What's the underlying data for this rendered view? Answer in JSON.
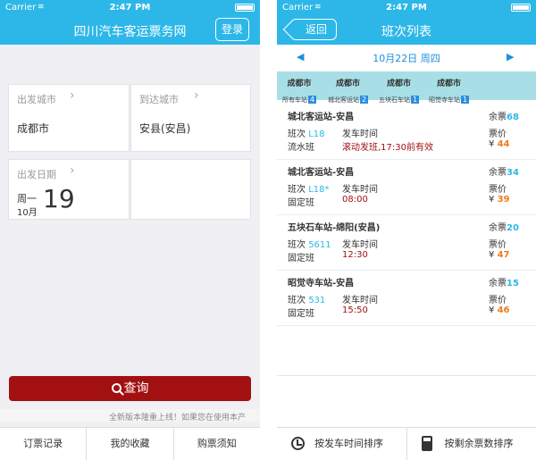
{
  "left": {
    "status": {
      "carrier": "Carrier",
      "wifi": "≋",
      "time": "2:47 PM"
    },
    "nav": {
      "title": "四川汽车客运票务网",
      "login": "登录"
    },
    "from": {
      "label": "出发城市",
      "value": "成都市"
    },
    "to": {
      "label": "到达城市",
      "value": "安县(安昌)"
    },
    "date": {
      "label": "出发日期",
      "weekday": "周一",
      "month": "10月",
      "day": "19"
    },
    "search": "查询",
    "notice": "全新版本隆重上线！如果您在使用本产",
    "tabs": [
      "订票记录",
      "我的收藏",
      "购票须知"
    ]
  },
  "right": {
    "status": {
      "carrier": "Carrier",
      "wifi": "≋",
      "time": "2:47 PM"
    },
    "nav": {
      "title": "班次列表",
      "back": "返回"
    },
    "datebar": {
      "prev": "◀",
      "date": "10月22日 周四",
      "next": "▶"
    },
    "stations": [
      {
        "city": "成都市",
        "name": "所有车站",
        "count": "4"
      },
      {
        "city": "成都市",
        "name": "城北客运站",
        "count": "2"
      },
      {
        "city": "成都市",
        "name": "五块石车站",
        "count": "1"
      },
      {
        "city": "成都市",
        "name": "昭觉寺车站",
        "count": "1"
      }
    ],
    "labels": {
      "remain": "余票",
      "trip": "班次",
      "depart": "发车时间",
      "price": "票价",
      "yen": "¥"
    },
    "trips": [
      {
        "route": "城北客运站-安昌",
        "remain": "68",
        "trip_no": "L18",
        "type": "流水班",
        "depart": "滚动发班,17:30前有效",
        "price": "44"
      },
      {
        "route": "城北客运站-安昌",
        "remain": "34",
        "trip_no": "L18*",
        "type": "固定班",
        "depart": "08:00",
        "price": "39"
      },
      {
        "route": "五块石车站-绵阳(安昌)",
        "remain": "20",
        "trip_no": "5611",
        "type": "固定班",
        "depart": "12:30",
        "price": "47"
      },
      {
        "route": "昭觉寺车站-安昌",
        "remain": "15",
        "trip_no": "531",
        "type": "固定班",
        "depart": "15:50",
        "price": "46"
      }
    ],
    "sort": [
      "按发车时间排序",
      "按剩余票数排序"
    ]
  }
}
